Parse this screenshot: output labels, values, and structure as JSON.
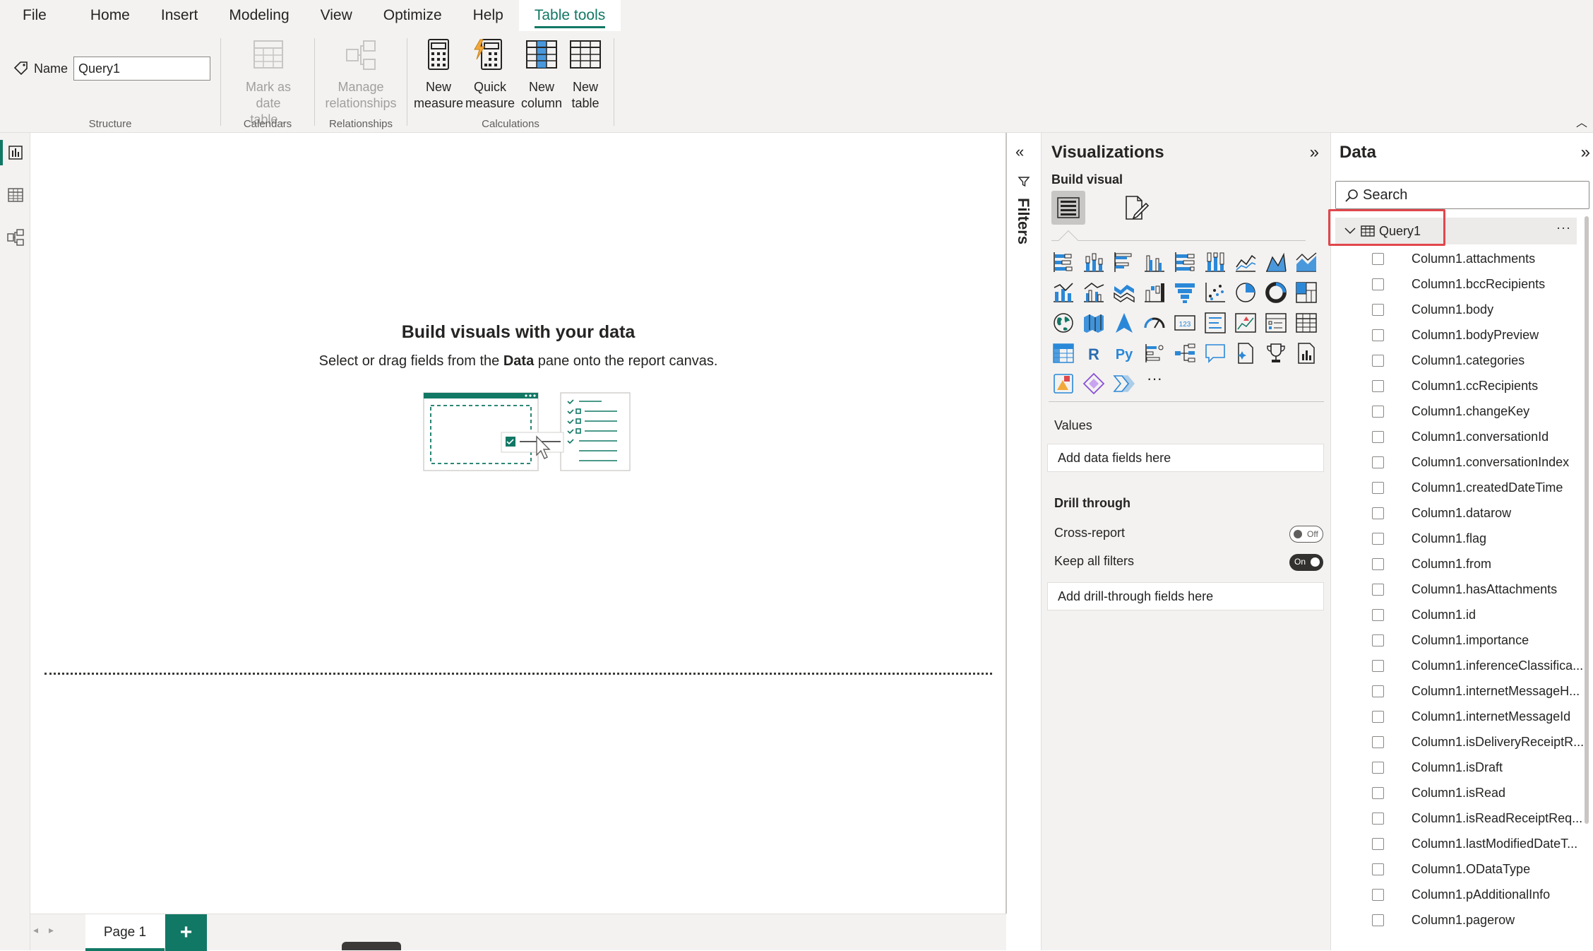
{
  "menu": {
    "items": [
      "File",
      "Home",
      "Insert",
      "Modeling",
      "View",
      "Optimize",
      "Help",
      "Table tools"
    ],
    "active": "Table tools"
  },
  "ribbon": {
    "name_label": "Name",
    "name_value": "Query1",
    "groups": {
      "structure": "Structure",
      "calendars": "Calendars",
      "relationships": "Relationships",
      "calculations": "Calculations"
    },
    "buttons": {
      "mark_date_1": "Mark as date",
      "mark_date_2": "table",
      "manage_rel_1": "Manage",
      "manage_rel_2": "relationships",
      "new_measure_1": "New",
      "new_measure_2": "measure",
      "quick_measure_1": "Quick",
      "quick_measure_2": "measure",
      "new_column_1": "New",
      "new_column_2": "column",
      "new_table_1": "New",
      "new_table_2": "table"
    }
  },
  "canvas": {
    "title": "Build visuals with your data",
    "sub_before": "Select or drag fields from the ",
    "sub_bold": "Data",
    "sub_after": " pane onto the report canvas."
  },
  "pages": {
    "tab": "Page 1",
    "add": "+"
  },
  "filters": {
    "label": "Filters"
  },
  "visualizations": {
    "title": "Visualizations",
    "build_visual": "Build visual",
    "values_label": "Values",
    "values_placeholder": "Add data fields here",
    "drill_through": "Drill through",
    "cross_report": "Cross-report",
    "cross_report_state": "Off",
    "keep_filters": "Keep all filters",
    "keep_filters_state": "On",
    "drill_placeholder": "Add drill-through fields here",
    "more": "···",
    "r_label": "R",
    "py_label": "Py",
    "kpi_label": "123"
  },
  "data_pane": {
    "title": "Data",
    "search_placeholder": "Search",
    "table_name": "Query1",
    "table_more": "···",
    "fields": [
      "Column1.attachments",
      "Column1.bccRecipients",
      "Column1.body",
      "Column1.bodyPreview",
      "Column1.categories",
      "Column1.ccRecipients",
      "Column1.changeKey",
      "Column1.conversationId",
      "Column1.conversationIndex",
      "Column1.createdDateTime",
      "Column1.datarow",
      "Column1.flag",
      "Column1.from",
      "Column1.hasAttachments",
      "Column1.id",
      "Column1.importance",
      "Column1.inferenceClassifica...",
      "Column1.internetMessageH...",
      "Column1.internetMessageId",
      "Column1.isDeliveryReceiptR...",
      "Column1.isDraft",
      "Column1.isRead",
      "Column1.isReadReceiptReq...",
      "Column1.lastModifiedDateT...",
      "Column1.ODataType",
      "Column1.pAdditionalInfo",
      "Column1.pagerow"
    ]
  },
  "colors": {
    "accent": "#117865",
    "viz_blue": "#2b88d8",
    "highlight": "#e0474c"
  }
}
